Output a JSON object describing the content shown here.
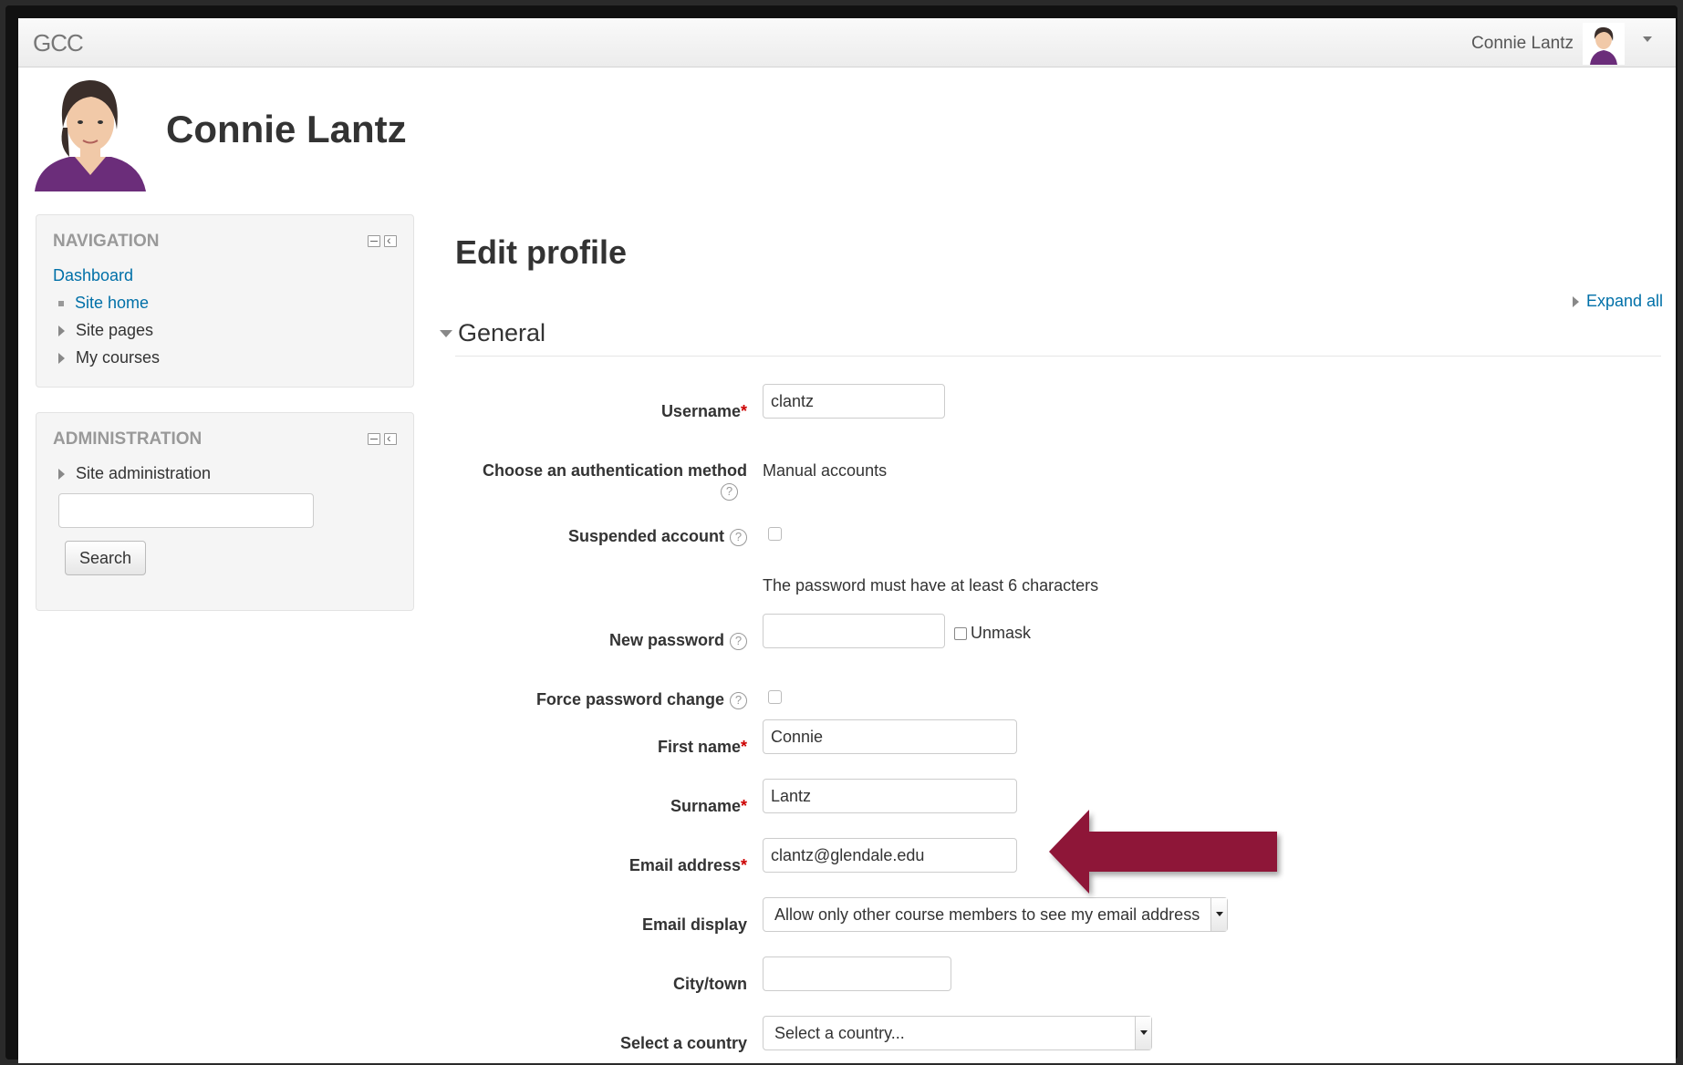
{
  "navbar": {
    "brand": "GCC",
    "user_name": "Connie Lantz"
  },
  "header": {
    "full_name": "Connie Lantz"
  },
  "blocks": {
    "navigation": {
      "title": "NAVIGATION",
      "dashboard": "Dashboard",
      "items": [
        "Site home",
        "Site pages",
        "My courses"
      ]
    },
    "administration": {
      "title": "ADMINISTRATION",
      "site_admin": "Site administration",
      "search_value": "",
      "search_button": "Search"
    }
  },
  "main": {
    "title": "Edit profile",
    "expand_all": "Expand all",
    "section_title": "General",
    "fields": {
      "username_label": "Username",
      "username_value": "clantz",
      "auth_label": "Choose an authentication method",
      "auth_value": "Manual accounts",
      "suspended_label": "Suspended account",
      "password_note": "The password must have at least 6 characters",
      "new_password_label": "New password",
      "new_password_value": "",
      "unmask_label": "Unmask",
      "force_change_label": "Force password change",
      "firstname_label": "First name",
      "firstname_value": "Connie",
      "surname_label": "Surname",
      "surname_value": "Lantz",
      "email_label": "Email address",
      "email_value": "clantz@glendale.edu",
      "email_display_label": "Email display",
      "email_display_value": "Allow only other course members to see my email address",
      "city_label": "City/town",
      "city_value": "",
      "country_label": "Select a country",
      "country_value": "Select a country..."
    },
    "required_mark": "*",
    "help_glyph": "?"
  },
  "colors": {
    "link": "#0070a8",
    "required": "#cc0000",
    "annotation_arrow": "#8e1238"
  }
}
